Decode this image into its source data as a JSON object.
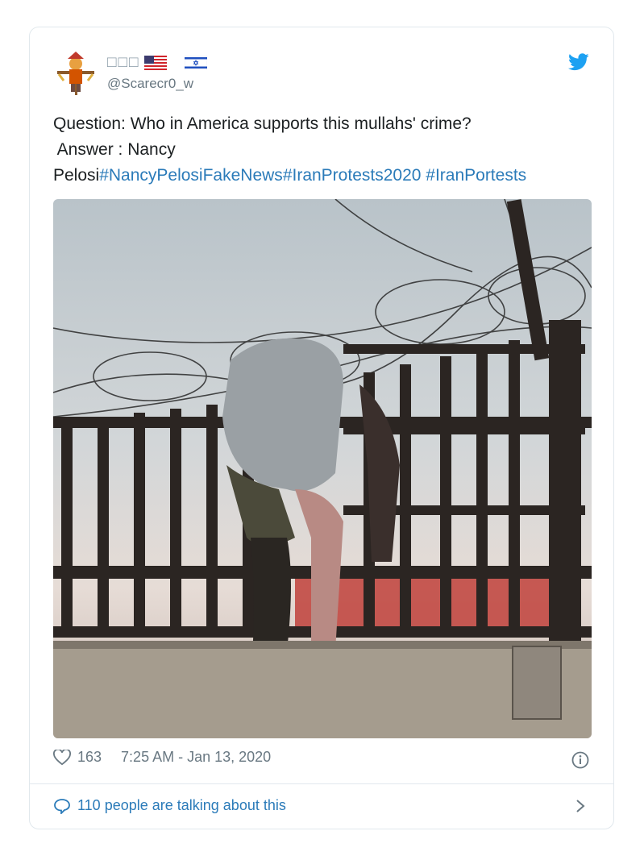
{
  "tweet": {
    "display_name": "□□□",
    "handle": "@Scarecr0_w",
    "text_plain_1": "Question: Who in America supports this mullahs' crime?",
    "text_plain_2": " Answer : Nancy",
    "text_plain_3": "Pelosi",
    "hashtag_1": "#NancyPelosiFakeNews",
    "hashtag_2": "#IranProtests2020",
    "hashtag_3": "#IranPortests",
    "likes": "163",
    "timestamp": "7:25 AM - Jan 13, 2020",
    "talking": "110 people are talking about this"
  },
  "colors": {
    "link": "#2b7bb9",
    "muted": "#697882",
    "border": "#e1e8ed",
    "twitter_blue": "#1da1f2"
  },
  "icons": {
    "brand": "twitter-bird-icon",
    "like": "heart-outline-icon",
    "info": "info-circle-icon",
    "reply": "speech-bubble-icon",
    "chevron": "chevron-right-icon",
    "flags": [
      "us-flag-icon",
      "israel-flag-icon"
    ]
  }
}
